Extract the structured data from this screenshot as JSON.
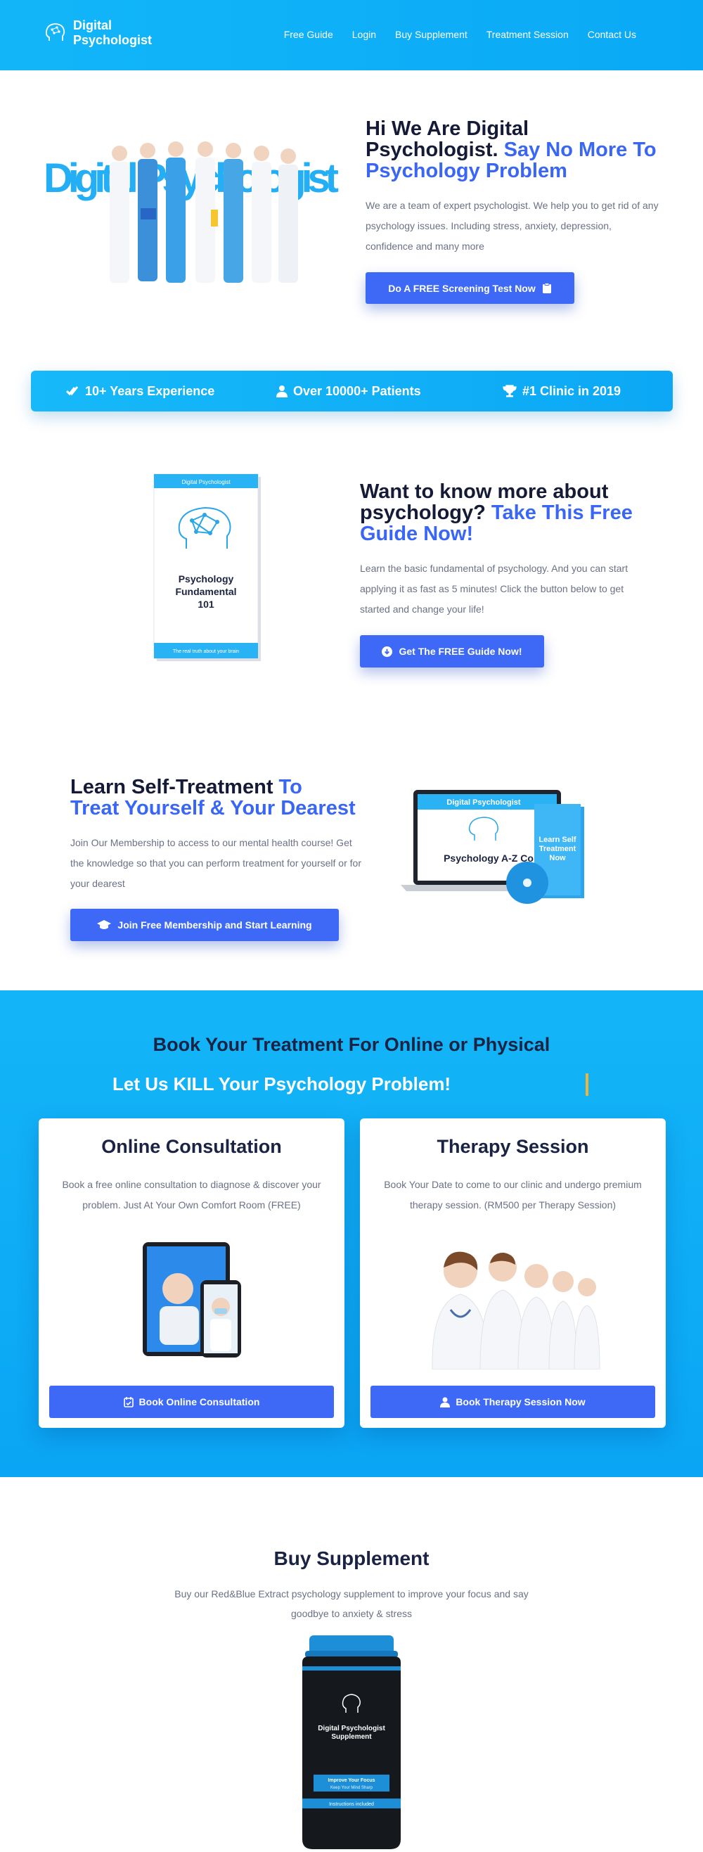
{
  "header": {
    "logo_line1": "Digital",
    "logo_line2": "Psychologist",
    "nav": [
      "Free Guide",
      "Login",
      "Buy Supplement",
      "Treatment Session",
      "Contact Us"
    ]
  },
  "hero": {
    "title_line1": "Hi We Are Digital",
    "title_line2": "Psychologist.",
    "title_accent_a": "Say No More To",
    "title_accent_b": "Psychology Problem",
    "description": "We are a team of expert psychologist. We help you to get rid of any psychology issues. Including stress, anxiety, depression, confidence and many more",
    "button": "Do A FREE Screening Test Now",
    "image_word": "Digital Psychologist"
  },
  "stats": [
    {
      "icon": "double-check-icon",
      "label": "10+ Years Experience"
    },
    {
      "icon": "user-icon",
      "label": "Over 10000+ Patients"
    },
    {
      "icon": "trophy-icon",
      "label": "#1 Clinic in 2019"
    }
  ],
  "guide": {
    "title_line1": "Want to know more about",
    "title_line2": "psychology?",
    "title_accent_a": "Take This Free",
    "title_accent_b": "Guide Now!",
    "description": "Learn the basic fundamental of psychology. And you can start applying it as fast as 5 minutes! Click the button below to get started and change your life!",
    "button": "Get The FREE Guide Now!",
    "book_header": "Digital Psychologist",
    "book_title": "Psychology Fundamental 101",
    "book_footer": "The real truth about your brain"
  },
  "self": {
    "title_line1": "Learn Self-Treatment",
    "title_accent_a": "To",
    "title_accent_b": "Treat Yourself & Your Dearest",
    "description": "Join Our Membership to access to our mental health course! Get the knowledge so that you can perform treatment for yourself or for your dearest",
    "button": "Join Free Membership and Start Learning",
    "laptop_header": "Digital Psychologist",
    "laptop_title": "Psychology A-Z Co",
    "box_title": "Learn Self Treatment Now"
  },
  "book": {
    "title": "Book Your Treatment For Online or Physical",
    "subtitle": "Let Us KILL Your Psychology Problem!",
    "cards": [
      {
        "title": "Online Consultation",
        "description": "Book a free online consultation to diagnose & discover your problem. Just At Your Own Comfort Room (FREE)",
        "button": "Book Online Consultation"
      },
      {
        "title": "Therapy Session",
        "description": "Book Your Date to come to our clinic and undergo premium therapy session. (RM500 per Therapy Session)",
        "button": "Book Therapy Session Now"
      }
    ]
  },
  "supplement": {
    "title": "Buy Supplement",
    "description": "Buy our Red&Blue Extract psychology supplement to improve your focus and say goodbye to anxiety & stress",
    "jar_brand": "Digital Psychologist Supplement",
    "jar_tag1": "Improve Your Focus",
    "jar_tag2": "Keep Your Mind Sharp",
    "jar_foot": "Instructions included"
  },
  "colors": {
    "header_bg": "#0aa9f6",
    "accent": "#3a66f5",
    "button": "#3e69f6",
    "heading": "#151b36",
    "cursor": "#f0b43a"
  }
}
